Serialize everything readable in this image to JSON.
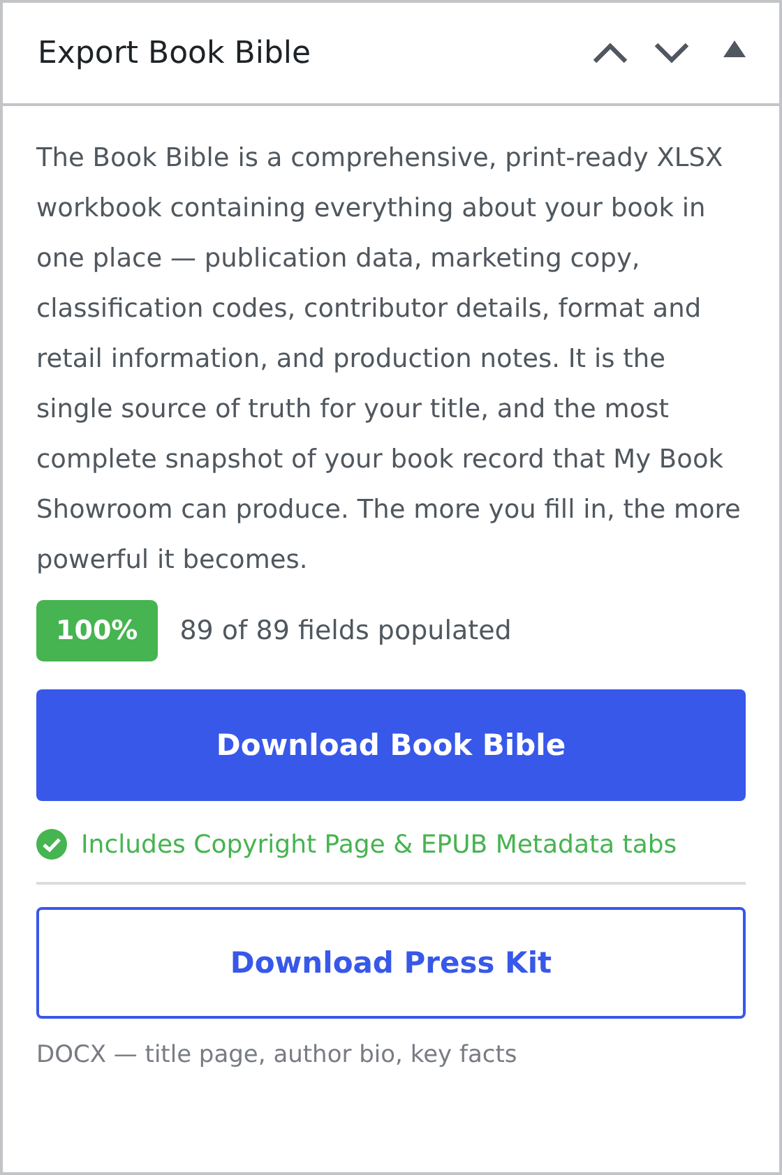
{
  "panel": {
    "title": "Export Book Bible",
    "controls": [
      {
        "kind": "up"
      },
      {
        "kind": "down"
      },
      {
        "kind": "toggle"
      }
    ]
  },
  "description": "The Book Bible is a comprehensive, print-ready XLSX workbook containing everything about your book in one place — publication data, marketing copy, classification codes, contributor details, format and retail information, and production notes. It is the single source of truth for your title, and the most complete snapshot of your book record that My Book Showroom can produce. The more you fill in, the more powerful it becomes.",
  "completeness": {
    "badge": "100%",
    "summary": "89 of 89 fields populated"
  },
  "primary_button": "Download Book Bible",
  "includes_note": "Includes Copyright Page & EPUB Metadata tabs",
  "secondary_button": "Download Press Kit",
  "secondary_note": "DOCX — title page, author bio, key facts"
}
